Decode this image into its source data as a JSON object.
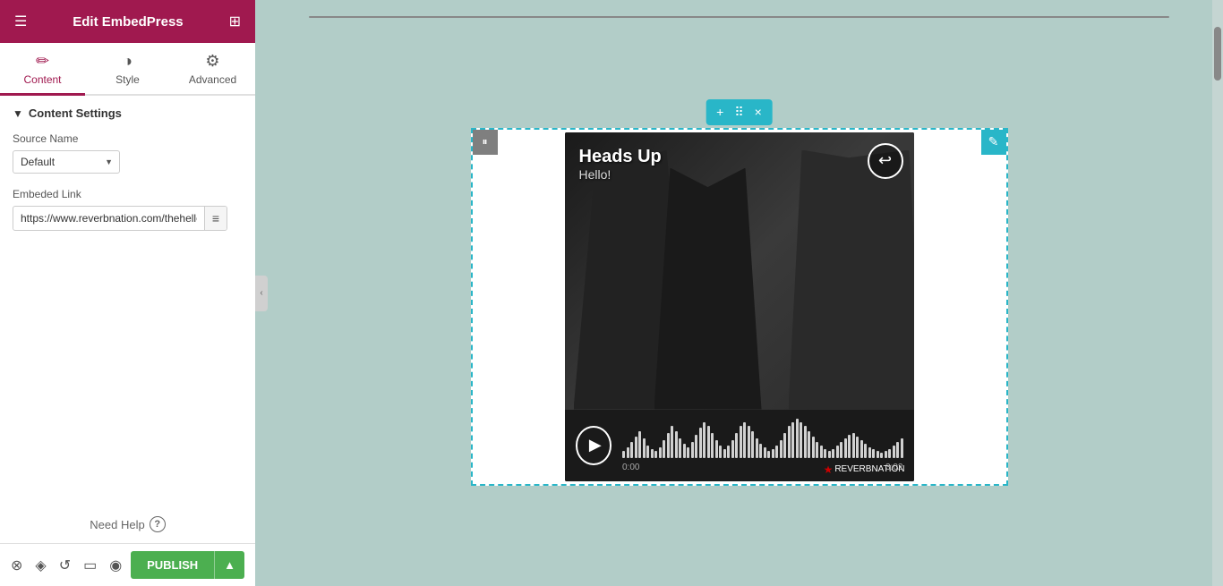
{
  "sidebar": {
    "title": "Edit EmbedPress",
    "tabs": [
      {
        "id": "content",
        "label": "Content",
        "icon": "✏️",
        "active": true
      },
      {
        "id": "style",
        "label": "Style",
        "icon": "🎨",
        "active": false
      },
      {
        "id": "advanced",
        "label": "Advanced",
        "icon": "⚙️",
        "active": false
      }
    ],
    "section": {
      "title": "Content Settings",
      "source_name_label": "Source Name",
      "source_name_default": "Default",
      "embed_link_label": "Embeded Link",
      "embed_link_value": "https://www.reverbnation.com/thehellc"
    },
    "need_help": "Need Help"
  },
  "bottom_bar": {
    "publish_label": "PUBLISH"
  },
  "embed": {
    "song_title": "Heads Up",
    "song_subtitle": "Hello!",
    "time_start": "0:00",
    "time_end": "3:02",
    "reverbnation": "REVERBNATION"
  },
  "toolbar": {
    "add_icon": "+",
    "move_icon": "⠿",
    "close_icon": "×"
  },
  "waveform_heights": [
    8,
    12,
    18,
    24,
    30,
    22,
    14,
    10,
    8,
    12,
    20,
    28,
    36,
    30,
    22,
    16,
    12,
    18,
    26,
    34,
    40,
    36,
    28,
    20,
    14,
    10,
    14,
    20,
    28,
    36,
    40,
    36,
    30,
    22,
    16,
    12,
    8,
    10,
    14,
    20,
    28,
    36,
    40,
    44,
    40,
    36,
    30,
    24,
    18,
    14,
    10,
    8,
    10,
    14,
    18,
    22,
    26,
    28,
    24,
    20,
    16,
    12,
    10,
    8,
    6,
    8,
    10,
    14,
    18,
    22
  ]
}
